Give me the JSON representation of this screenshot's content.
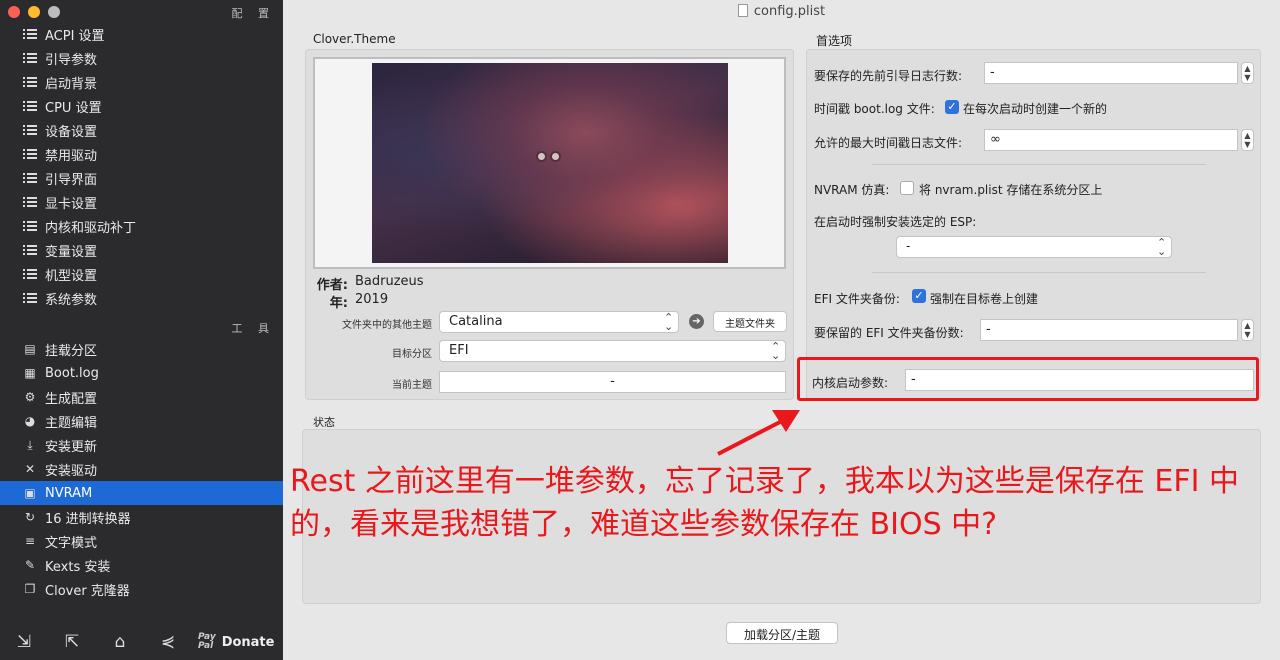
{
  "window": {
    "title": "config.plist"
  },
  "sidebar": {
    "config_header": "配 置",
    "config_items": [
      {
        "label": "ACPI 设置"
      },
      {
        "label": "引导参数"
      },
      {
        "label": "启动背景"
      },
      {
        "label": "CPU 设置"
      },
      {
        "label": "设备设置"
      },
      {
        "label": "禁用驱动"
      },
      {
        "label": "引导界面"
      },
      {
        "label": "显卡设置"
      },
      {
        "label": "内核和驱动补丁"
      },
      {
        "label": "变量设置"
      },
      {
        "label": "机型设置"
      },
      {
        "label": "系统参数"
      }
    ],
    "tools_header": "工 具",
    "tool_items": [
      {
        "label": "挂载分区",
        "icon": "disk-icon"
      },
      {
        "label": "Boot.log",
        "icon": "log-icon"
      },
      {
        "label": "生成配置",
        "icon": "gears-icon"
      },
      {
        "label": "主题编辑",
        "icon": "palette-icon"
      },
      {
        "label": "安装更新",
        "icon": "download-icon"
      },
      {
        "label": "安装驱动",
        "icon": "tools-icon"
      },
      {
        "label": "NVRAM",
        "icon": "chip-icon",
        "active": true
      },
      {
        "label": "16 进制转换器",
        "icon": "refresh-icon"
      },
      {
        "label": "文字模式",
        "icon": "text-lines-icon"
      },
      {
        "label": "Kexts 安装",
        "icon": "pen-icon"
      },
      {
        "label": "Clover 克隆器",
        "icon": "copy-icon"
      }
    ],
    "donate": {
      "paypal_top": "Pay",
      "paypal_bottom": "Pal",
      "label": "Donate"
    }
  },
  "theme": {
    "group_title": "Clover.Theme",
    "author_label": "作者:",
    "author_value": "Badruzeus",
    "year_label": "年:",
    "year_value": "2019",
    "other_themes_label": "文件夹中的其他主题",
    "other_themes_value": "Catalina",
    "theme_folder_button": "主题文件夹",
    "target_partition_label": "目标分区",
    "target_partition_value": "EFI",
    "current_theme_label": "当前主题",
    "current_theme_value": "-"
  },
  "prefs": {
    "group_title": "首选项",
    "boot_log_count_label": "要保存的先前引导日志行数:",
    "boot_log_count_value": "-",
    "timestamp_label": "时间戳 boot.log 文件:",
    "timestamp_checkbox": "在每次启动时创建一个新的",
    "max_timestamp_label": "允许的最大时间戳日志文件:",
    "max_timestamp_value": "∞",
    "nvram_emu_label": "NVRAM 仿真:",
    "nvram_emu_checkbox": "将 nvram.plist 存储在系统分区上",
    "force_esp_label": "在启动时强制安装选定的 ESP:",
    "force_esp_value": "-",
    "efi_backup_label": "EFI 文件夹备份:",
    "efi_backup_checkbox": "强制在目标卷上创建",
    "efi_backup_count_label": "要保留的 EFI 文件夹备份数:",
    "efi_backup_count_value": "-",
    "kernel_args_label": "内核启动参数:",
    "kernel_args_value": "-"
  },
  "status": {
    "label": "状态"
  },
  "load_button": "加载分区/主题",
  "annotation": {
    "text": "Rest 之前这里有一堆参数，忘了记录了，我本以为这些是保存在 EFI 中的，看来是我想错了，难道这些参数保存在 BIOS 中?",
    "color": "#e8181c"
  },
  "colors": {
    "sidebar_bg": "#2b2b2d",
    "accent": "#1d69d6"
  }
}
